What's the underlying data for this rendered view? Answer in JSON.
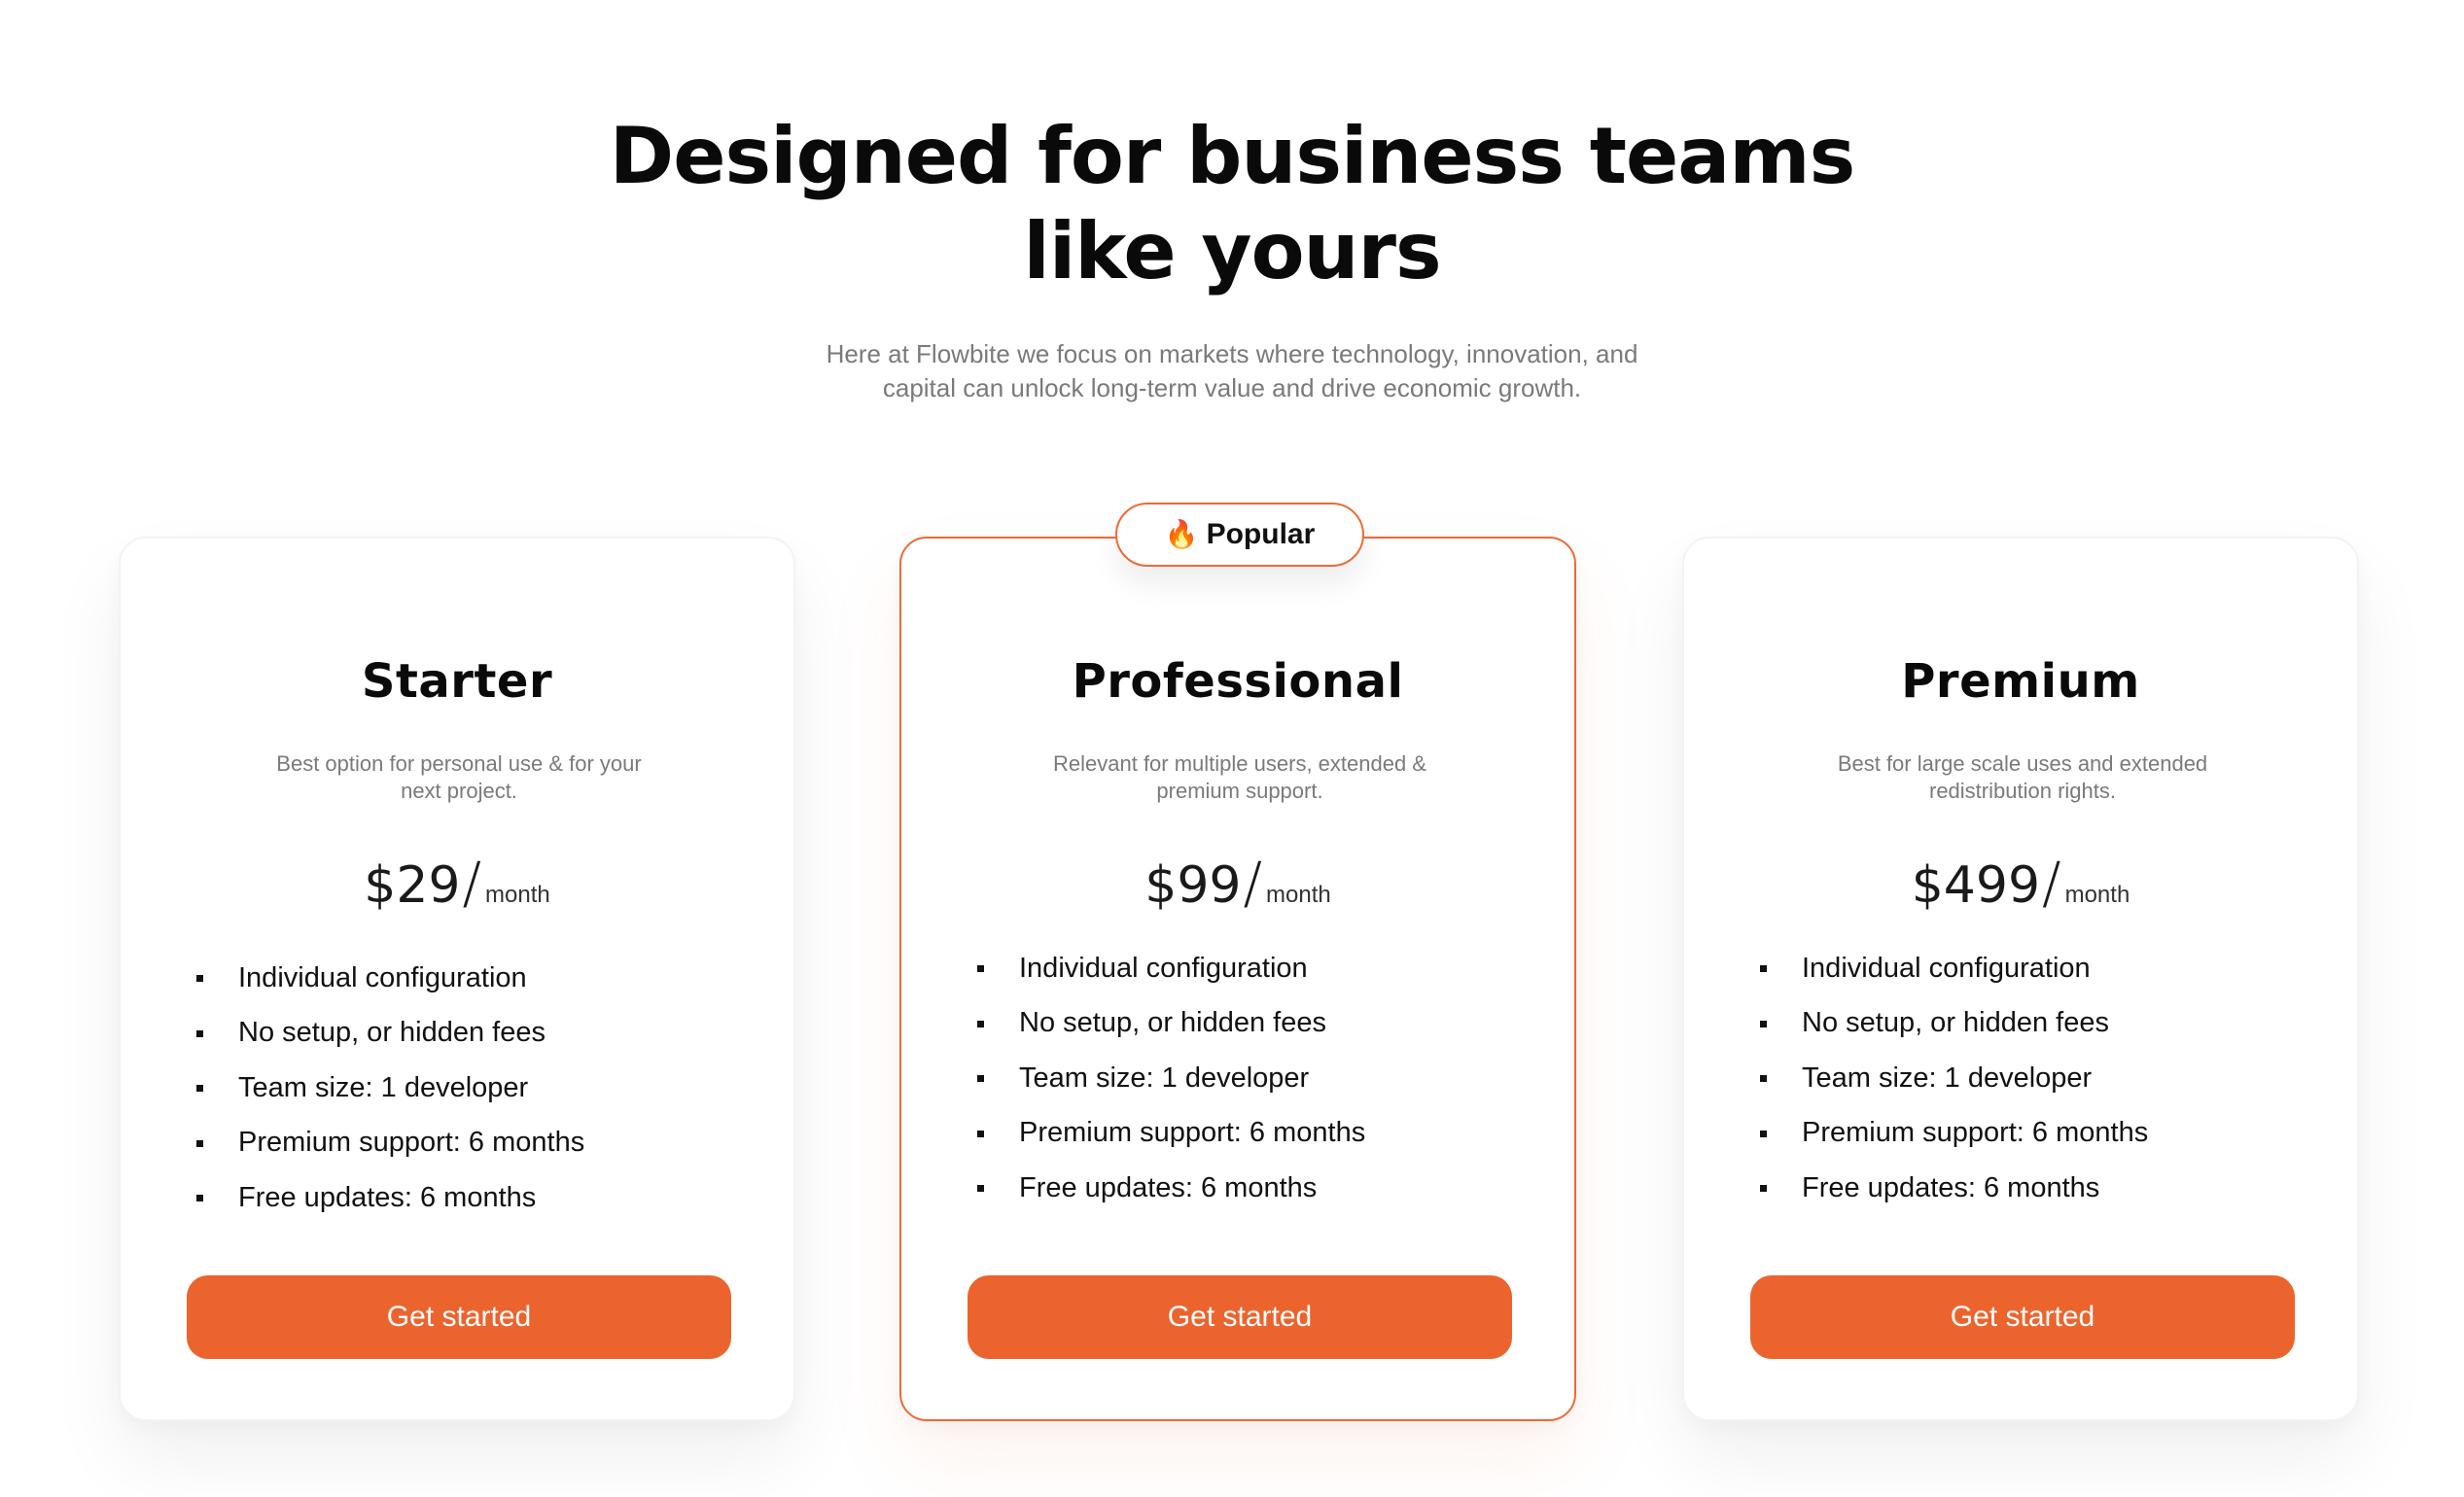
{
  "header": {
    "title_line1": "Designed for business teams",
    "title_line2": "like yours",
    "subtitle_line1": "Here at Flowbite we focus on markets where technology, innovation, and",
    "subtitle_line2": "capital can unlock long-term value and drive economic growth."
  },
  "colors": {
    "accent": "#ec642d",
    "featured_border": "#ee6a35",
    "muted_text": "#7a7a7a"
  },
  "plans": [
    {
      "name": "Starter",
      "description_line1": "Best option for personal use & for your",
      "description_line2": "next project.",
      "price": "$29",
      "period": "month",
      "features": [
        "Individual configuration",
        "No setup, or hidden fees",
        "Team size: 1 developer",
        "Premium support: 6 months",
        "Free updates: 6 months"
      ],
      "cta_label": "Get started"
    },
    {
      "name": "Professional",
      "badge": {
        "icon": "fire-icon",
        "glyph": "🔥",
        "label": "Popular"
      },
      "description_line1": "Relevant for multiple users, extended &",
      "description_line2": "premium support.",
      "price": "$99",
      "period": "month",
      "features": [
        "Individual configuration",
        "No setup, or hidden fees",
        "Team size: 1 developer",
        "Premium support: 6 months",
        "Free updates: 6 months"
      ],
      "cta_label": "Get started"
    },
    {
      "name": "Premium",
      "description_line1": "Best for large scale uses and extended",
      "description_line2": "redistribution rights.",
      "price": "$499",
      "period": "month",
      "features": [
        "Individual configuration",
        "No setup, or hidden fees",
        "Team size: 1 developer",
        "Premium support: 6 months",
        "Free updates: 6 months"
      ],
      "cta_label": "Get started"
    }
  ]
}
